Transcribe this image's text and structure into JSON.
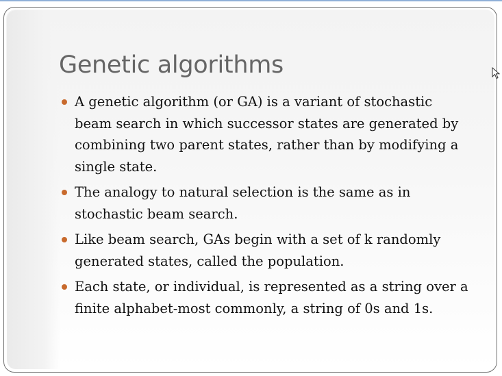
{
  "slide": {
    "title": "Genetic algorithms",
    "bullets": [
      "A genetic algorithm (or GA) is a variant of stochastic beam search in which successor states are generated by combining two parent states, rather than by modifying a single state.",
      "The analogy to natural selection is the same as in stochastic beam search.",
      "Like beam search, GAs begin with a set of k randomly generated states, called the population.",
      "Each state, or individual, is represented as a string over a finite alphabet-most commonly, a string of 0s and 1s."
    ]
  },
  "colors": {
    "bullet": "#c86a2d",
    "title": "#666666",
    "frame_border": "#6f6f6f"
  },
  "icons": {
    "cursor": "mouse-pointer-icon"
  }
}
